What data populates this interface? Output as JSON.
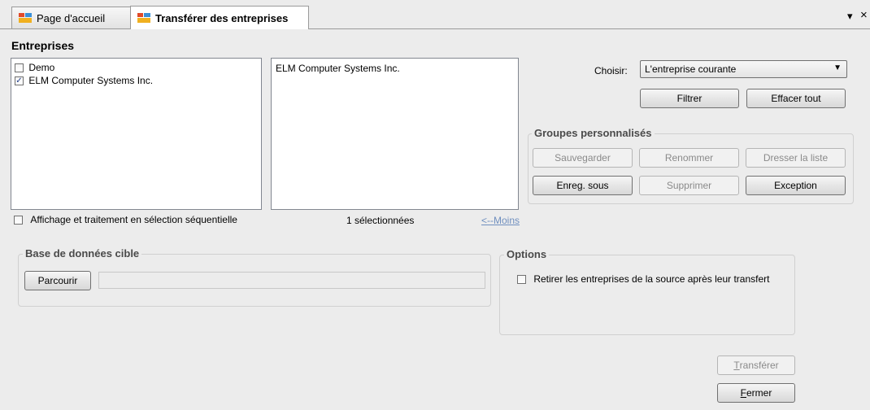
{
  "tabs": [
    {
      "label": "Page d'accueil",
      "active": false
    },
    {
      "label": "Transférer des entreprises",
      "active": true
    }
  ],
  "tab_controls": {
    "menu": "▾",
    "close": "×"
  },
  "entreprises": {
    "title": "Entreprises",
    "items": [
      {
        "label": "Demo",
        "checked": false
      },
      {
        "label": "ELM Computer Systems Inc.",
        "checked": true
      }
    ],
    "selected_list": [
      "ELM Computer Systems Inc."
    ],
    "sequential_label": "Affichage et traitement en sélection séquentielle",
    "selected_count": "1 sélectionnées",
    "less_link": "<--Moins"
  },
  "choose": {
    "label": "Choisir:",
    "value": "L'entreprise courante",
    "filter_button": "Filtrer",
    "clear_button": "Effacer tout"
  },
  "custom_groups": {
    "title": "Groupes personnalisés",
    "save": "Sauvegarder",
    "rename": "Renommer",
    "list": "Dresser la liste",
    "save_as": "Enreg. sous",
    "delete": "Supprimer",
    "exception": "Exception"
  },
  "target_db": {
    "title": "Base de données cible",
    "browse_button": "Parcourir",
    "path_value": ""
  },
  "options": {
    "title": "Options",
    "remove_label": "Retirer les entreprises de la source après leur transfert",
    "remove_checked": false
  },
  "footer": {
    "transfer_first": "T",
    "transfer_rest": "ransférer",
    "close_first": "F",
    "close_rest": "ermer"
  }
}
